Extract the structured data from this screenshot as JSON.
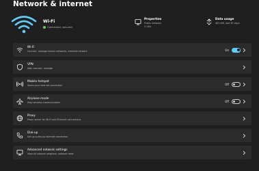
{
  "page": {
    "title": "Network & internet"
  },
  "hero": {
    "network_name": "Wi-Fi",
    "status": "Connected, secured",
    "status_color": "#6ccb5f",
    "properties_label": "Properties",
    "properties_line1": "Public network",
    "properties_line2": "5 GHz",
    "data_usage_label": "Data usage",
    "data_usage_value": "481 MB, last 30 days"
  },
  "rows": [
    {
      "label": "Wi-Fi",
      "description": "Connect, manage known networks, metered network",
      "state": "On",
      "toggle": true,
      "icon": "wifi-icon"
    },
    {
      "label": "VPN",
      "description": "Add, connect, manage",
      "icon": "shield-icon"
    },
    {
      "label": "Mobile hotspot",
      "description": "Share your internet connection",
      "state": "Off",
      "toggle": false,
      "icon": "hotspot-icon"
    },
    {
      "label": "Airplane mode",
      "description": "Stop wireless communication",
      "state": "Off",
      "toggle": false,
      "icon": "airplane-icon"
    },
    {
      "label": "Proxy",
      "description": "Proxy server for Wi-Fi and Ethernet connections",
      "icon": "globe-icon"
    },
    {
      "label": "Dial-up",
      "description": "Set up a dial-up internet connection",
      "icon": "phone-icon"
    },
    {
      "label": "Advanced network settings",
      "description": "View all network adapters, network reset",
      "icon": "monitor-icon"
    }
  ],
  "colors": {
    "accent": "#60cdff",
    "background": "#1f1f1f",
    "row_background": "#2b2b2b"
  }
}
